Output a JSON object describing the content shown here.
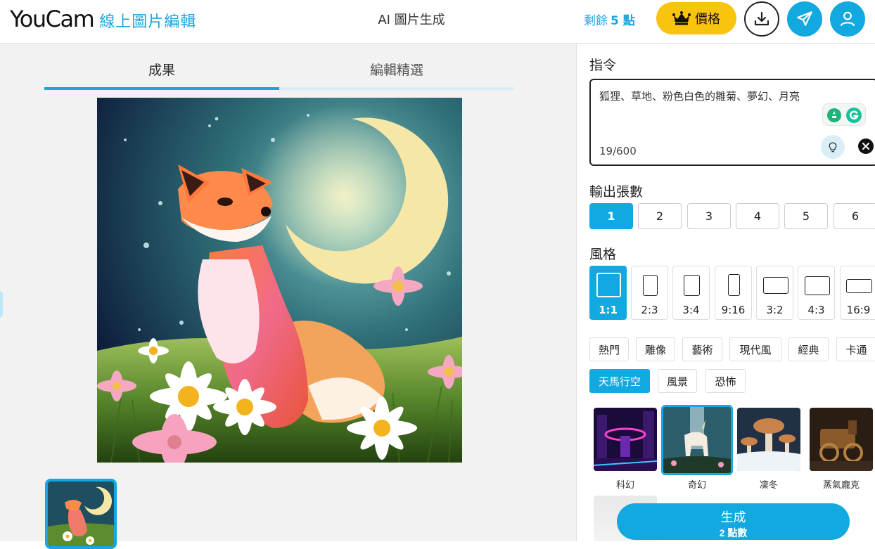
{
  "header": {
    "logo_main": "YouCam",
    "logo_sub": "線上圖片編輯",
    "title": "AI 圖片生成",
    "credits_label": "剩餘",
    "credits_value": "5 點",
    "price_label": "價格",
    "icons": {
      "price": "crown-icon",
      "download": "download-icon",
      "share": "send-icon",
      "account": "user-icon"
    }
  },
  "canvas": {
    "tabs": [
      {
        "label": "成果",
        "active": true
      },
      {
        "label": "編輯精選",
        "active": false
      }
    ]
  },
  "panel": {
    "prompt_label": "指令",
    "prompt_value": "狐狸、草地、粉色白色的雛菊、夢幻、月亮",
    "prompt_count": "19/600",
    "count_label": "輸出張數",
    "counts": [
      "1",
      "2",
      "3",
      "4",
      "5",
      "6"
    ],
    "count_selected": "1",
    "style_label": "風格",
    "ratios": [
      "1:1",
      "2:3",
      "3:4",
      "9:16",
      "3:2",
      "4:3",
      "16:9"
    ],
    "ratio_selected": "1:1",
    "categories_row1": [
      "熱門",
      "雕像",
      "藝術",
      "現代風",
      "經典",
      "卡通"
    ],
    "categories_row2": [
      "天馬行空",
      "風景",
      "恐怖"
    ],
    "category_selected": "天馬行空",
    "styles": [
      "科幻",
      "奇幻",
      "凜冬",
      "蒸氣龐克"
    ],
    "style_selected": "奇幻",
    "generate_label": "生成",
    "generate_cost": "2 點數"
  },
  "colors": {
    "accent": "#12a8e0",
    "price": "#f9c40e",
    "logo_sub": "#1aa6d9"
  }
}
